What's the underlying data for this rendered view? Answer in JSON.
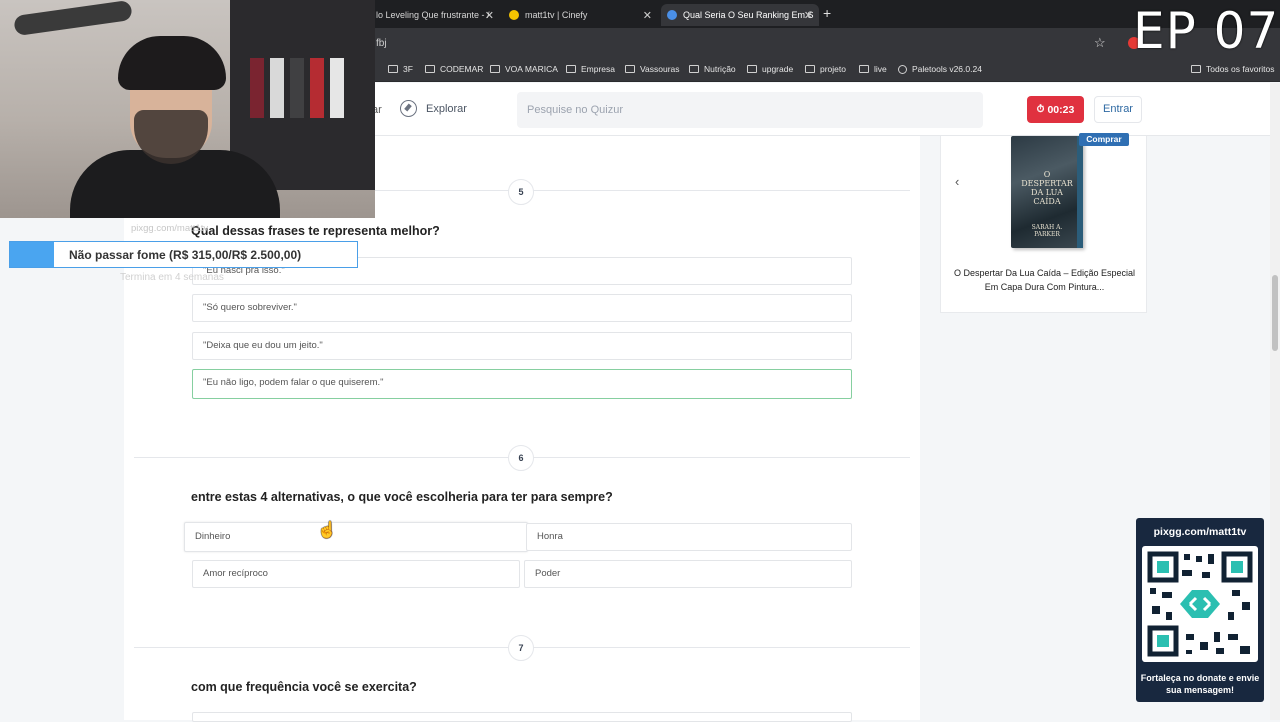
{
  "browser": {
    "tabs": [
      {
        "title": "lo Leveling Que frustrante - /"
      },
      {
        "title": "matt1tv | Cinefy"
      },
      {
        "title": "Qual Seria O Seu Ranking Em S"
      }
    ],
    "url_fragment": "fbj",
    "bookmarks": [
      "3F",
      "CODEMAR",
      "VOA MARICA",
      "Empresa",
      "Vassouras",
      "Nutrição",
      "upgrade",
      "projeto",
      "live",
      "Paletools v26.0.24"
    ],
    "all_favorites": "Todos os favoritos"
  },
  "overlay": {
    "episode": "EP 07",
    "goal": {
      "label": "Não passar fome (R$ 315,00/R$ 2.500,00)",
      "progress": 0.126
    },
    "ghost_top": "pixgg.com/matt1tv",
    "ghost_bottom": "Termina em 4 semanas",
    "qr": {
      "url": "pixgg.com/matt1tv",
      "caption": "Fortaleça no donate e envie sua mensagem!"
    }
  },
  "header": {
    "nav_fragment": "ar",
    "explore": "Explorar",
    "search_placeholder": "Pesquise no Quizur",
    "timer": "00:23",
    "login": "Entrar"
  },
  "questions": [
    {
      "number": "5",
      "title": "Qual dessas frases te representa melhor?",
      "options": [
        "\"Eu nasci pra isso.\"",
        "\"Só quero sobreviver.\"",
        "\"Deixa que eu dou um jeito.\"",
        "\"Eu não ligo, podem falar o que quiserem.\""
      ],
      "selected_index": 3
    },
    {
      "number": "6",
      "title": "entre estas 4 alternativas, o que você escolheria para ter para sempre?",
      "options": [
        "Dinheiro",
        "Honra",
        "Amor recíproco",
        "Poder"
      ]
    },
    {
      "number": "7",
      "title": "com que frequência você se exercita?",
      "options": []
    }
  ],
  "sidebar": {
    "buy_label": "Comprar",
    "book_cover_title": "O DESPERTAR DA LUA CAÍDA",
    "book_cover_author": "SARAH A. PARKER",
    "product_title": "O Despertar Da Lua Caída – Edição Especial Em Capa Dura Com Pintura..."
  },
  "colors": {
    "accent": "#2f6aa3",
    "timer": "#e0313f",
    "selected_border": "#86cfa0",
    "qr_bg": "#18283f"
  }
}
